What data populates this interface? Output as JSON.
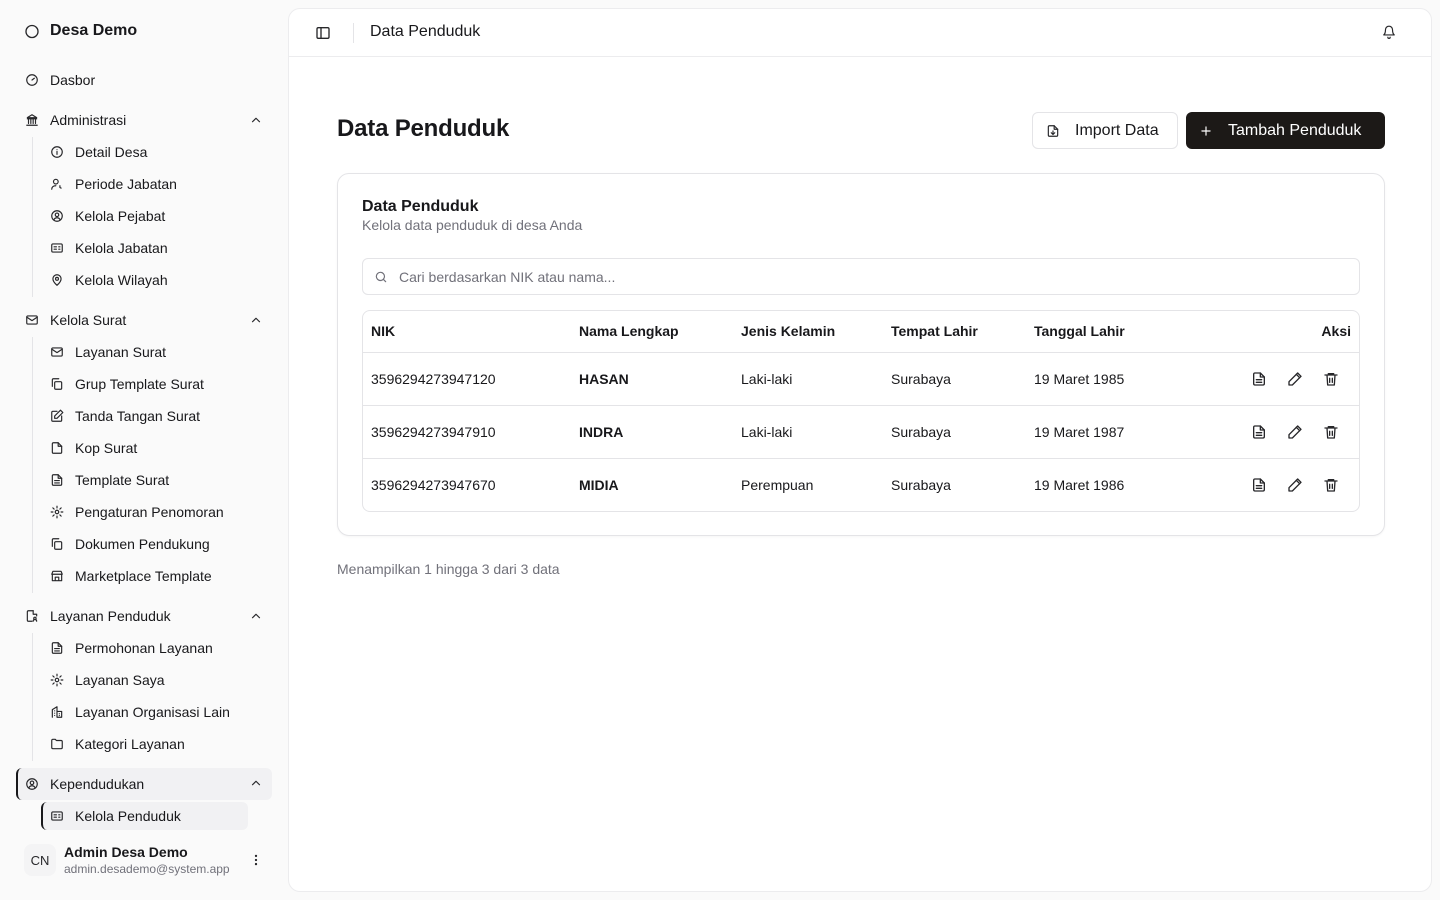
{
  "app": {
    "name": "Desa Demo"
  },
  "sidebar": {
    "dashboard": "Dasbor",
    "groups": [
      {
        "label": "Administrasi",
        "items": [
          "Detail Desa",
          "Periode Jabatan",
          "Kelola Pejabat",
          "Kelola Jabatan",
          "Kelola Wilayah"
        ]
      },
      {
        "label": "Kelola Surat",
        "items": [
          "Layanan Surat",
          "Grup Template Surat",
          "Tanda Tangan Surat",
          "Kop Surat",
          "Template Surat",
          "Pengaturan Penomoran",
          "Dokumen Pendukung",
          "Marketplace Template"
        ]
      },
      {
        "label": "Layanan Penduduk",
        "items": [
          "Permohonan Layanan",
          "Layanan Saya",
          "Layanan Organisasi Lain",
          "Kategori Layanan"
        ]
      },
      {
        "label": "Kependudukan",
        "items": [
          "Kelola Penduduk"
        ]
      }
    ],
    "user": {
      "initials": "CN",
      "name": "Admin Desa Demo",
      "email": "admin.desademo@system.app"
    }
  },
  "topbar": {
    "title": "Data Penduduk"
  },
  "page": {
    "title": "Data Penduduk",
    "import_label": "Import Data",
    "add_label": "Tambah Penduduk"
  },
  "card": {
    "title": "Data Penduduk",
    "subtitle": "Kelola data penduduk di desa Anda",
    "search_placeholder": "Cari berdasarkan NIK atau nama..."
  },
  "table": {
    "columns": [
      "NIK",
      "Nama Lengkap",
      "Jenis Kelamin",
      "Tempat Lahir",
      "Tanggal Lahir",
      "Aksi"
    ],
    "rows": [
      {
        "nik": "3596294273947120",
        "nama": "HASAN",
        "jk": "Laki-laki",
        "tempat": "Surabaya",
        "tgl": "19 Maret 1985"
      },
      {
        "nik": "3596294273947910",
        "nama": "INDRA",
        "jk": "Laki-laki",
        "tempat": "Surabaya",
        "tgl": "19 Maret 1987"
      },
      {
        "nik": "3596294273947670",
        "nama": "MIDIA",
        "jk": "Perempuan",
        "tempat": "Surabaya",
        "tgl": "19 Maret 1986"
      }
    ]
  },
  "pagination": {
    "info": "Menampilkan 1 hingga 3 dari 3 data"
  }
}
